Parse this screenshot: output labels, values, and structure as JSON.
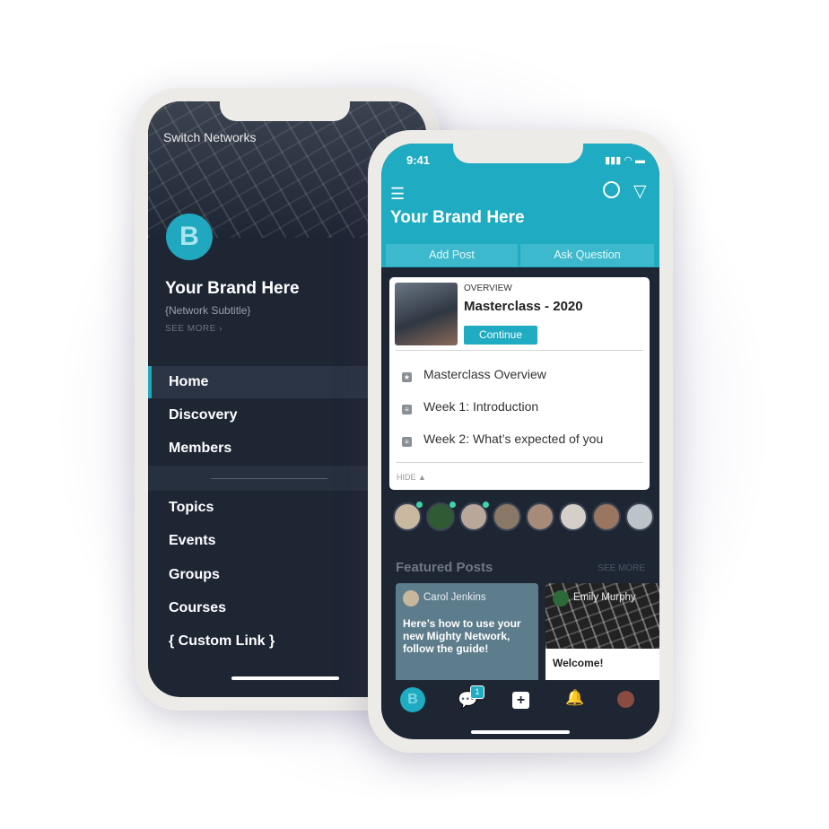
{
  "left_phone": {
    "switch_label": "Switch Networks",
    "logo_letter": "B",
    "title": "Your Brand Here",
    "subtitle": "{Network Subtitle}",
    "see_more": "SEE MORE ›",
    "menu_primary": [
      "Home",
      "Discovery",
      "Members"
    ],
    "menu_secondary": [
      "Topics",
      "Events",
      "Groups",
      "Courses",
      "{ Custom Link }"
    ],
    "active_item": "Home"
  },
  "right_phone": {
    "time": "9:41",
    "status_icons": "signal wifi battery",
    "title": "Your Brand Here",
    "menu_icon": "hamburger-icon",
    "search_icon": "search-icon",
    "filter_icon": "filter-icon",
    "actions": [
      "Add Post",
      "Ask Question"
    ],
    "course": {
      "kicker": "OVERVIEW",
      "title": "Masterclass - 2020",
      "button": "Continue",
      "items": [
        "Masterclass Overview",
        "Week 1: Introduction",
        "Week 2: What’s expected of you"
      ],
      "hide": "HIDE ▲"
    },
    "avatar_count": 8,
    "featured": {
      "title": "Featured Posts",
      "see_more": "SEE MORE",
      "posts": [
        {
          "author": "Carol Jenkins",
          "text": "Here’s how to use your new Mighty Network, follow the guide!"
        },
        {
          "author": "Emily Murphy",
          "text": "Welcome!"
        }
      ]
    },
    "nav": {
      "chat_badge": "1",
      "logo_letter": "B"
    }
  },
  "colors": {
    "accent": "#1fabc1",
    "dark": "#1e2634",
    "frame": "#ecebe7"
  }
}
